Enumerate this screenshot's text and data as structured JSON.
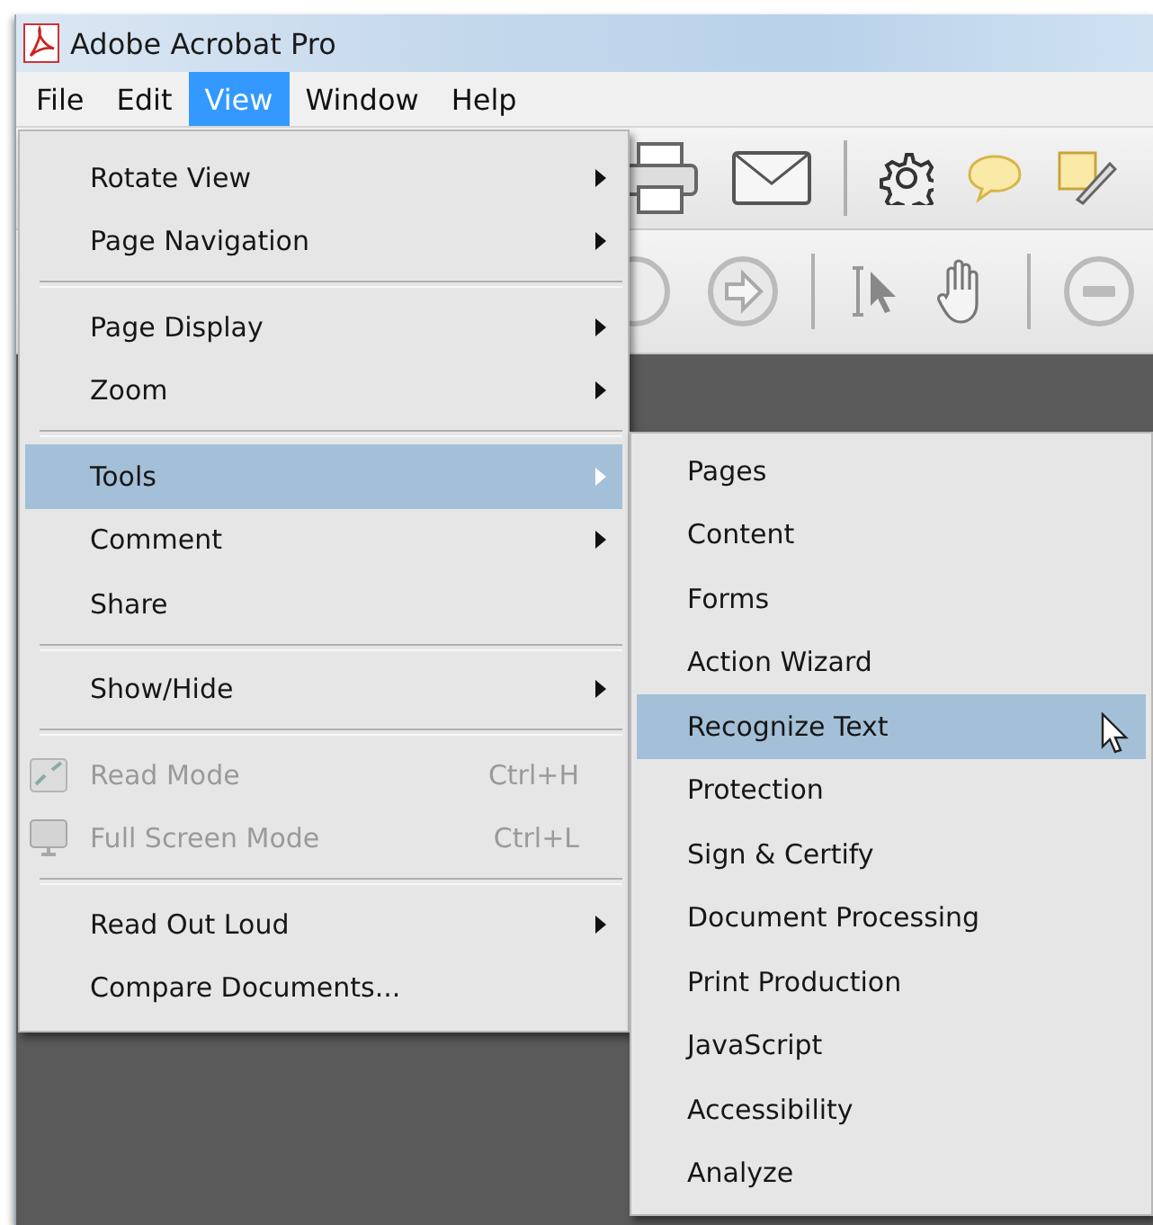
{
  "window": {
    "title": "Adobe Acrobat Pro"
  },
  "menubar": [
    {
      "label": "File",
      "selected": false
    },
    {
      "label": "Edit",
      "selected": false
    },
    {
      "label": "View",
      "selected": true
    },
    {
      "label": "Window",
      "selected": false
    },
    {
      "label": "Help",
      "selected": false
    }
  ],
  "view_menu": [
    {
      "kind": "item",
      "label": "Rotate View",
      "submenu": true,
      "selected": false,
      "disabled": false
    },
    {
      "kind": "item",
      "label": "Page Navigation",
      "submenu": true,
      "selected": false,
      "disabled": false
    },
    {
      "kind": "separator"
    },
    {
      "kind": "item",
      "label": "Page Display",
      "submenu": true,
      "selected": false,
      "disabled": false
    },
    {
      "kind": "item",
      "label": "Zoom",
      "submenu": true,
      "selected": false,
      "disabled": false
    },
    {
      "kind": "separator"
    },
    {
      "kind": "item",
      "label": "Tools",
      "submenu": true,
      "selected": true,
      "disabled": false
    },
    {
      "kind": "item",
      "label": "Comment",
      "submenu": true,
      "selected": false,
      "disabled": false
    },
    {
      "kind": "item",
      "label": "Share",
      "submenu": false,
      "selected": false,
      "disabled": false
    },
    {
      "kind": "separator"
    },
    {
      "kind": "item",
      "label": "Show/Hide",
      "submenu": true,
      "selected": false,
      "disabled": false
    },
    {
      "kind": "separator"
    },
    {
      "kind": "mode-item",
      "label": "Read Mode",
      "shortcut": "Ctrl+H",
      "submenu": false,
      "selected": false,
      "disabled": true
    },
    {
      "kind": "mode-item",
      "label": "Full Screen Mode",
      "shortcut": "Ctrl+L",
      "submenu": false,
      "selected": false,
      "disabled": true
    },
    {
      "kind": "separator"
    },
    {
      "kind": "item",
      "label": "Read Out Loud",
      "submenu": true,
      "selected": false,
      "disabled": false
    },
    {
      "kind": "item",
      "label": "Compare Documents...",
      "submenu": false,
      "selected": false,
      "disabled": false
    }
  ],
  "tools_submenu": [
    {
      "label": "Pages",
      "selected": false
    },
    {
      "label": "Content",
      "selected": false
    },
    {
      "label": "Forms",
      "selected": false
    },
    {
      "label": "Action Wizard",
      "selected": false
    },
    {
      "label": "Recognize Text",
      "selected": true
    },
    {
      "label": "Protection",
      "selected": false
    },
    {
      "label": "Sign & Certify",
      "selected": false
    },
    {
      "label": "Document Processing",
      "selected": false
    },
    {
      "label": "Print Production",
      "selected": false
    },
    {
      "label": "JavaScript",
      "selected": false
    },
    {
      "label": "Accessibility",
      "selected": false
    },
    {
      "label": "Analyze",
      "selected": false
    }
  ]
}
